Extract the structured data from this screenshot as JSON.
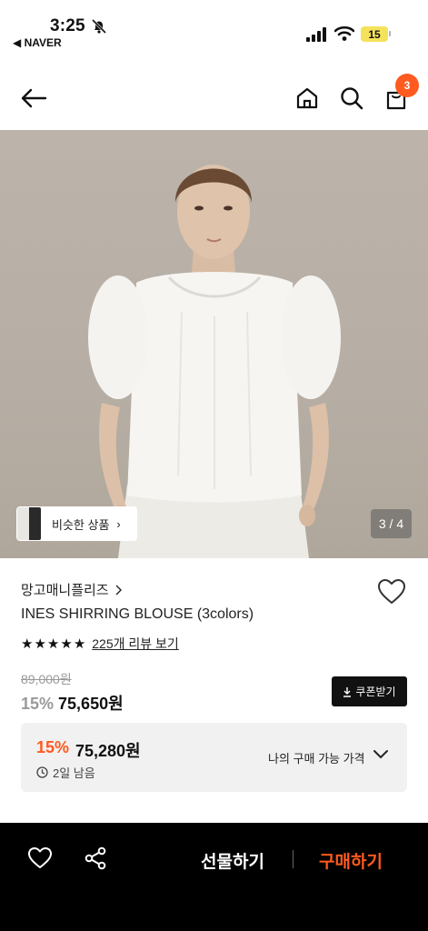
{
  "status": {
    "time": "3:25",
    "back_app": "◀ NAVER",
    "battery": "15"
  },
  "nav": {
    "cart_count": "3"
  },
  "hero": {
    "similar_label": "비슷한 상품",
    "page_indicator": "3 / 4"
  },
  "product": {
    "brand": "망고매니플리즈",
    "title": "INES SHIRRING BLOUSE (3colors)",
    "rating_stars": 5,
    "review_link": "225개 리뷰 보기",
    "original_price": "89,000원",
    "sale_rate": "15%",
    "sale_price": "75,650원",
    "coupon_label": "쿠폰받기"
  },
  "my_price": {
    "rate": "15%",
    "price": "75,280원",
    "timer": "2일 남음",
    "label": "나의 구매 가능 가격"
  },
  "bottom_bar": {
    "gift_label": "선물하기",
    "buy_label": "구매하기"
  },
  "colors": {
    "accent": "#ff5a1f",
    "dark": "#111111",
    "box_bg": "#f1f1f1"
  }
}
